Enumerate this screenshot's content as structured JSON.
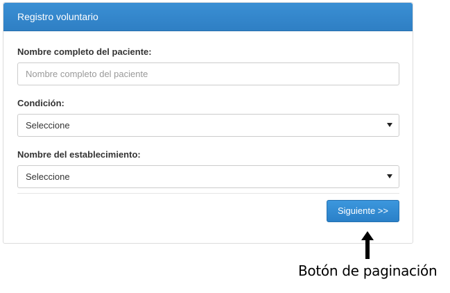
{
  "panel": {
    "title": "Registro voluntario"
  },
  "form": {
    "patient_name": {
      "label": "Nombre completo del paciente:",
      "placeholder": "Nombre completo del paciente",
      "value": ""
    },
    "condition": {
      "label": "Condición:",
      "selected": "Seleccione"
    },
    "establishment": {
      "label": "Nombre del establecimiento:",
      "selected": "Seleccione"
    },
    "next_button_label": "Siguiente >>"
  },
  "annotation": {
    "text": "Botón de paginación",
    "arrow_icon": "up-arrow-icon"
  },
  "colors": {
    "header": "#3488cc",
    "button": "#3189d0"
  }
}
